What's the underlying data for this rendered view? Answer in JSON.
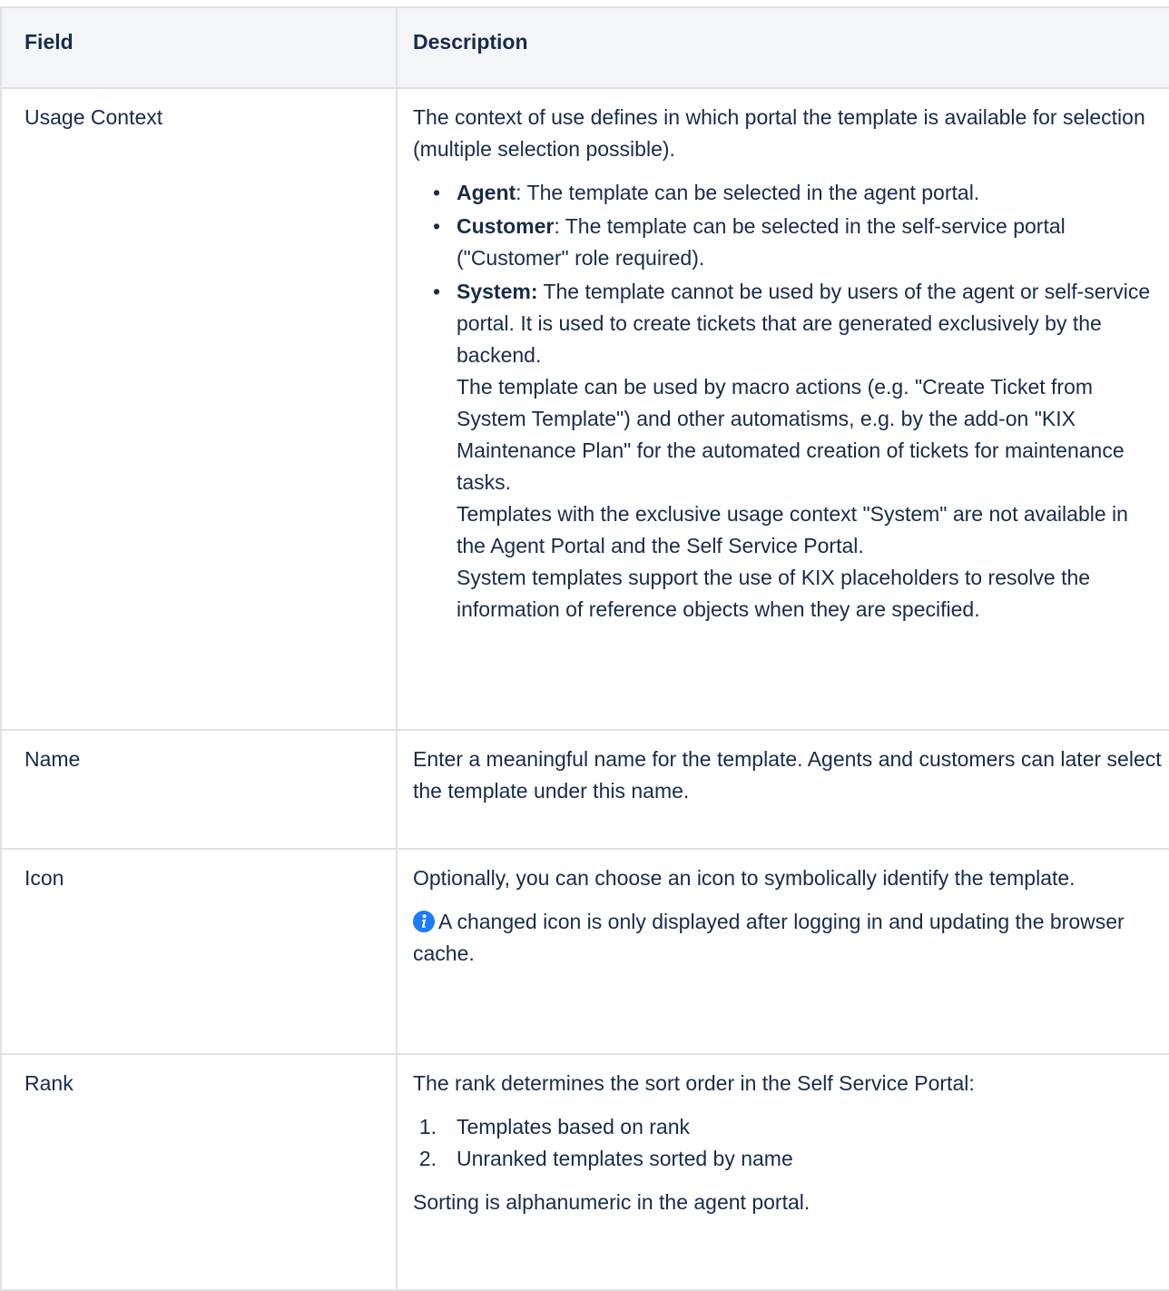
{
  "table": {
    "headers": {
      "field": "Field",
      "description": "Description"
    },
    "rows": {
      "usage_context": {
        "field": "Usage Context",
        "intro": "The context of use defines in which portal the template is available for selection (multiple selection possible).",
        "bullets": [
          {
            "term": "Agent",
            "text": ": The template can be selected in the agent portal."
          },
          {
            "term": "Customer",
            "text": ": The template can be selected in the self-service portal (\"Customer\" role required)."
          },
          {
            "term": "System:",
            "text": " The template cannot be used by users of the agent or self-service portal. It is used to create tickets that are generated exclusively by the backend.",
            "para2": "The template can be used by macro actions (e.g. \"Create Ticket from System Template\") and other automatisms, e.g. by the add-on \"KIX Maintenance Plan\" for the automated creation of tickets for maintenance tasks.",
            "para3": "Templates with the exclusive usage context \"System\" are not available in the Agent Portal and the Self Service Portal.",
            "para4": "System templates support the use of KIX placeholders to resolve the information of reference objects when they are specified."
          }
        ]
      },
      "name": {
        "field": "Name",
        "description": "Enter a meaningful name for the template. Agents and customers can later select the template under this name."
      },
      "icon": {
        "field": "Icon",
        "description": "Optionally, you can choose an icon to symbolically identify the template.",
        "info_note": "A changed icon is only displayed after logging in and updating the browser cache.",
        "info_icon": "info-icon"
      },
      "rank": {
        "field": "Rank",
        "intro": "The rank determines the sort order in the Self Service Portal:",
        "list": [
          {
            "number": "1.",
            "text": "Templates based on rank"
          },
          {
            "number": "2.",
            "text": "Unranked templates sorted by name"
          }
        ],
        "outro": "Sorting is alphanumeric in the agent portal."
      }
    }
  },
  "colors": {
    "text": "#172b4d",
    "header_bg": "#f4f5f7",
    "border": "#dfe1e6",
    "info_icon": "#1d7afc"
  }
}
